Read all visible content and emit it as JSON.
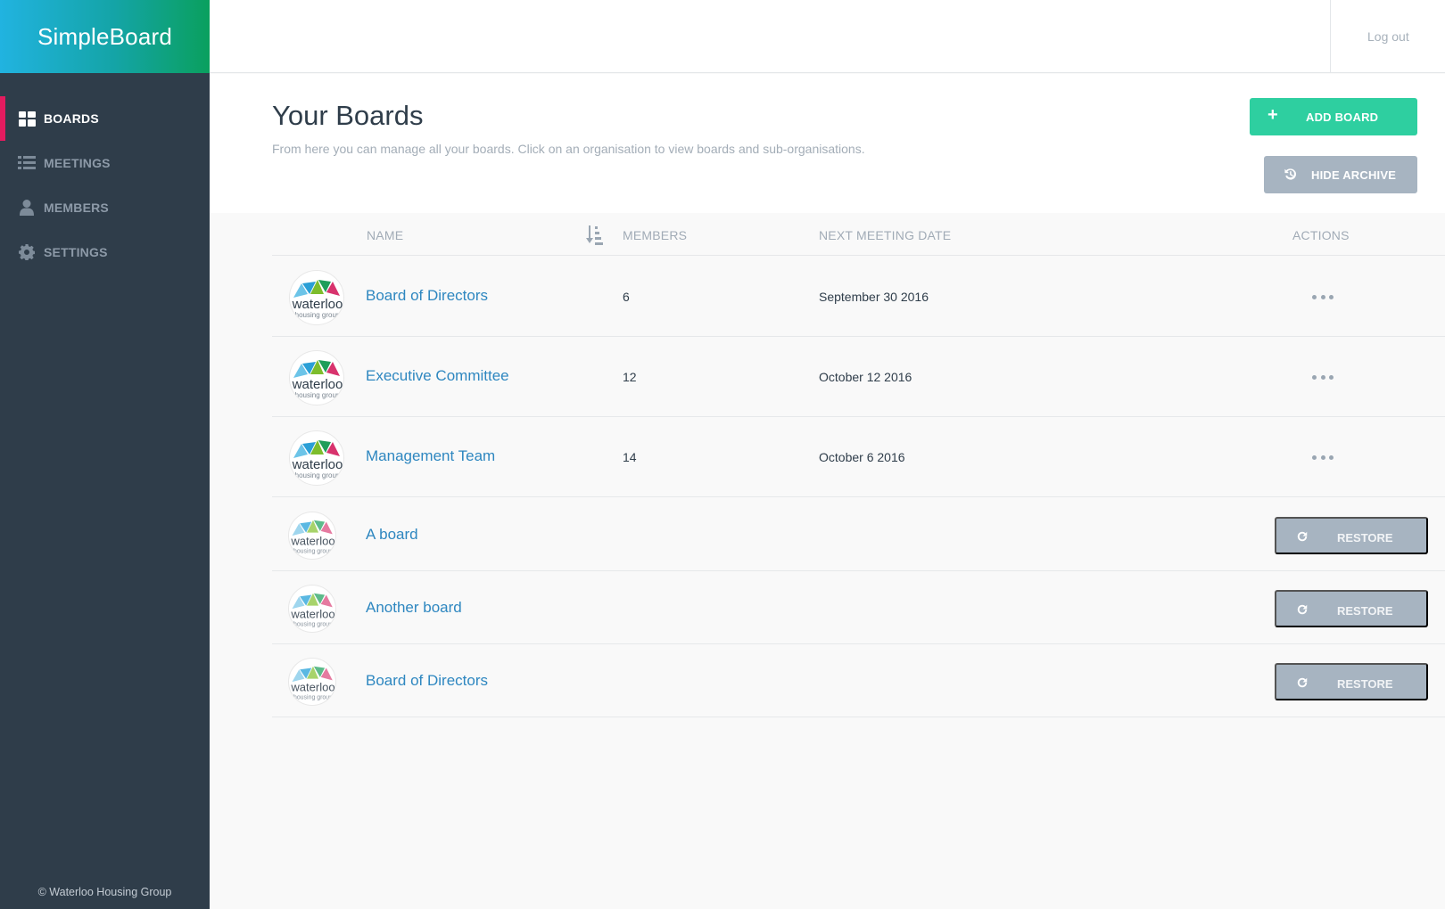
{
  "app": {
    "brand": "SimpleBoard",
    "copyright": "© Waterloo Housing Group"
  },
  "topbar": {
    "logout": "Log out"
  },
  "sidebar": {
    "items": [
      {
        "label": "BOARDS",
        "icon": "grid-icon",
        "active": true
      },
      {
        "label": "MEETINGS",
        "icon": "list-icon",
        "active": false
      },
      {
        "label": "MEMBERS",
        "icon": "user-icon",
        "active": false
      },
      {
        "label": "SETTINGS",
        "icon": "gear-icon",
        "active": false
      }
    ]
  },
  "page": {
    "title": "Your Boards",
    "subtitle": "From here you can manage all your boards. Click on an organisation to view boards and sub-organisations.",
    "add_button": "ADD BOARD",
    "add_icon": "+",
    "archive_button": "HIDE ARCHIVE"
  },
  "table": {
    "columns": {
      "name": "NAME",
      "members": "MEMBERS",
      "next_meeting": "NEXT MEETING DATE",
      "actions": "ACTIONS"
    },
    "rows": [
      {
        "name": "Board of Directors",
        "members": "6",
        "next_meeting": "September 30 2016"
      },
      {
        "name": "Executive Committee",
        "members": "12",
        "next_meeting": "October 12 2016"
      },
      {
        "name": "Management Team",
        "members": "14",
        "next_meeting": "October 6 2016"
      }
    ],
    "archived": [
      {
        "name": "A board",
        "action": "RESTORE"
      },
      {
        "name": "Another board",
        "action": "RESTORE"
      },
      {
        "name": "Board of Directors",
        "action": "RESTORE"
      }
    ],
    "logo_text": {
      "line1": "waterloo",
      "line2": "housing group"
    }
  },
  "colors": {
    "accent": "#2ecfa0",
    "sidebar": "#2f3d4a",
    "active_marker": "#e31b5f",
    "link": "#2e87c0",
    "muted_button": "#a7b4c1"
  }
}
